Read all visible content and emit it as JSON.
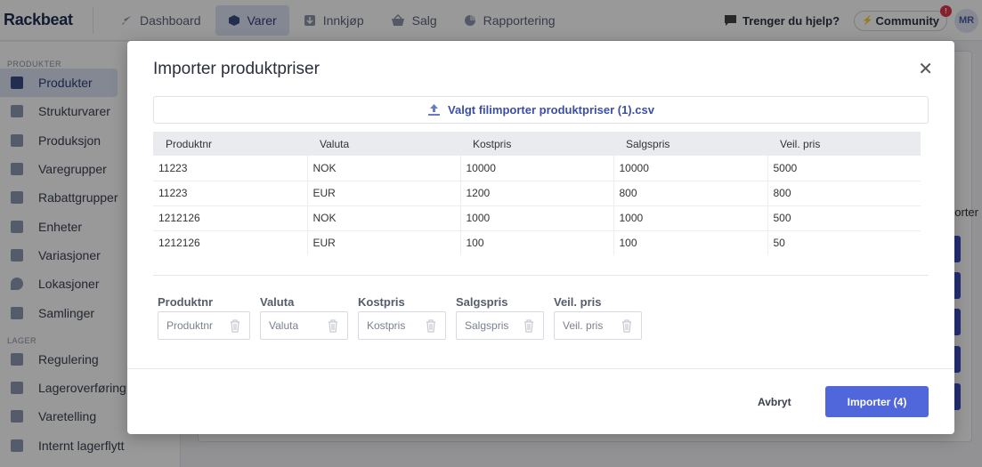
{
  "app": {
    "logo": "Rackbeat",
    "nav": [
      {
        "label": "Dashboard",
        "icon": "rocket-icon",
        "active": false
      },
      {
        "label": "Varer",
        "icon": "box-icon",
        "active": true
      },
      {
        "label": "Innkjøp",
        "icon": "download-icon",
        "active": false
      },
      {
        "label": "Salg",
        "icon": "basket-icon",
        "active": false
      },
      {
        "label": "Rapportering",
        "icon": "pie-chart-icon",
        "active": false
      }
    ],
    "help_label": "Trenger du hjelp?",
    "community_label": "Community",
    "community_badge": "!",
    "avatar_initials": "MR",
    "accent": "#4f67db"
  },
  "sidebar": {
    "sections": [
      {
        "heading": "PRODUKTER",
        "items": [
          {
            "label": "Produkter",
            "active": true
          },
          {
            "label": "Strukturvarer"
          },
          {
            "label": "Produksjon"
          },
          {
            "label": "Varegrupper"
          },
          {
            "label": "Rabattgrupper"
          },
          {
            "label": "Enheter"
          },
          {
            "label": "Variasjoner"
          },
          {
            "label": "Lokasjoner"
          },
          {
            "label": "Samlinger"
          }
        ]
      },
      {
        "heading": "LAGER",
        "items": [
          {
            "label": "Regulering"
          },
          {
            "label": "Lageroverføring"
          },
          {
            "label": "Varetelling"
          },
          {
            "label": "Internt lagerflytt"
          }
        ]
      }
    ]
  },
  "background": {
    "partial_text": "orter"
  },
  "modal": {
    "title": "Importer produktpriser",
    "close_symbol": "✕",
    "file_label": "Valgt fil",
    "file_name": "importer produktpriser (1).csv",
    "table": {
      "headers": [
        "Produktnr",
        "Valuta",
        "Kostpris",
        "Salgspris",
        "Veil. pris"
      ],
      "rows": [
        [
          "11223",
          "NOK",
          "10000",
          "10000",
          "5000"
        ],
        [
          "11223",
          "EUR",
          "1200",
          "800",
          "800"
        ],
        [
          "1212126",
          "NOK",
          "1000",
          "1000",
          "500"
        ],
        [
          "1212126",
          "EUR",
          "100",
          "100",
          "50"
        ]
      ]
    },
    "mapping": [
      {
        "label": "Produktnr",
        "placeholder": "Produktnr"
      },
      {
        "label": "Valuta",
        "placeholder": "Valuta"
      },
      {
        "label": "Kostpris",
        "placeholder": "Kostpris"
      },
      {
        "label": "Salgspris",
        "placeholder": "Salgspris"
      },
      {
        "label": "Veil. pris",
        "placeholder": "Veil. pris"
      }
    ],
    "cancel_label": "Avbryt",
    "import_label": "Importer (4)"
  }
}
